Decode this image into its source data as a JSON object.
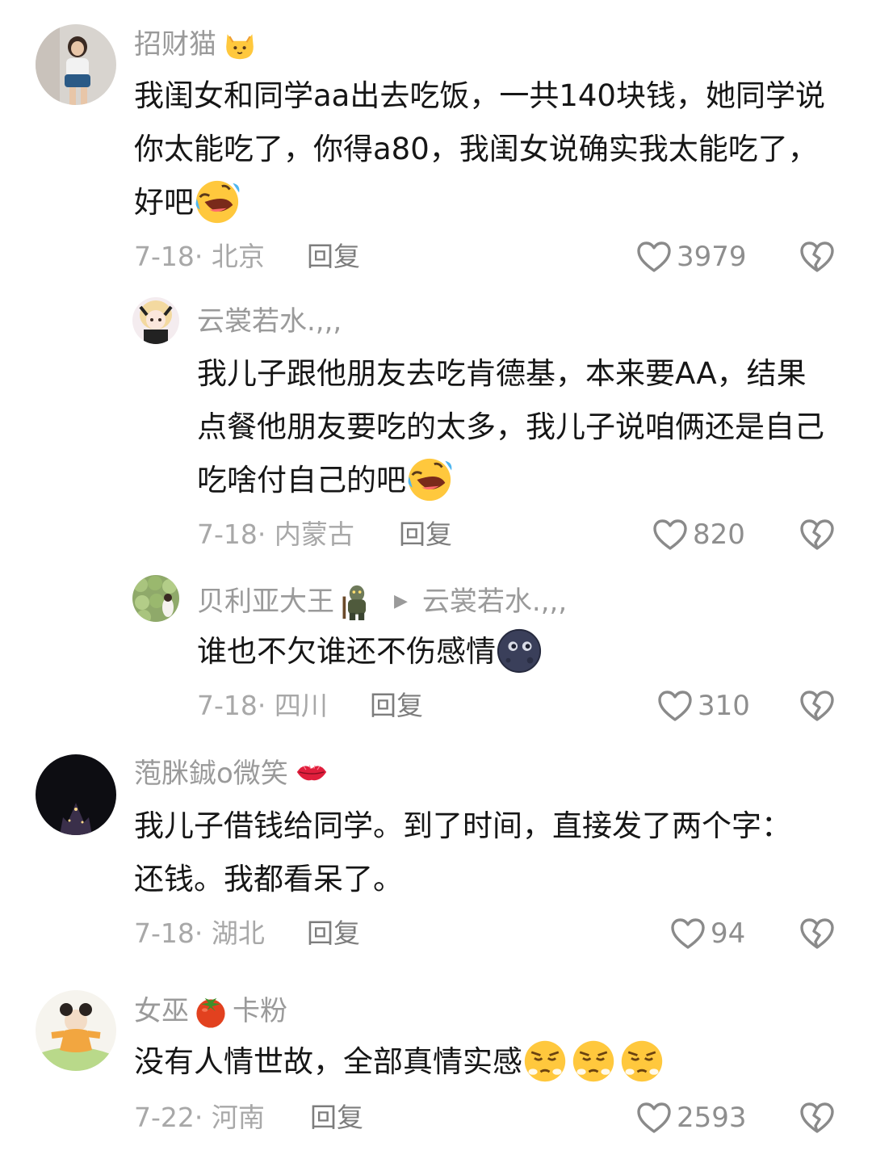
{
  "comments": [
    {
      "user": "招财猫",
      "text": "我闺女和同学aa出去吃饭，一共140块钱，她同学说你太能吃了，你得a80，我闺女说确实我太能吃了，好吧",
      "date_location": "7-18· 北京",
      "reply_label": "回复",
      "likes": "3979",
      "avatar_icon": "girl-photo-avatar",
      "badge_icon": "cat-face-emoji",
      "emoji": [
        "rofl-crying-emoji"
      ]
    },
    {
      "user": "云裳若水.,,,",
      "text": "我儿子跟他朋友去吃肯德基，本来要AA，结果点餐他朋友要吃的太多，我儿子说咱俩还是自己吃啥付自己的吧",
      "date_location": "7-18· 内蒙古",
      "reply_label": "回复",
      "likes": "820",
      "avatar_icon": "anime-girl-avatar",
      "emoji": [
        "rofl-crying-emoji"
      ]
    },
    {
      "user": "贝利亚大王",
      "reply_to": "云裳若水.,,,",
      "text": "谁也不欠谁还不伤感情",
      "date_location": "7-18· 四川",
      "reply_label": "回复",
      "likes": "310",
      "avatar_icon": "melon-field-avatar",
      "badge_icon": "troll-figure-icon",
      "emoji": [
        "new-moon-face-emoji"
      ]
    },
    {
      "user": "萢脒鋮ο微笑",
      "text": "我儿子借钱给同学。到了时间，直接发了两个字：还钱。我都看呆了。",
      "date_location": "7-18· 湖北",
      "reply_label": "回复",
      "likes": "94",
      "avatar_icon": "night-castle-avatar",
      "badge_icon": "kiss-lips-emoji"
    },
    {
      "user_parts": [
        "女巫",
        "卡粉"
      ],
      "text": "没有人情世故，全部真情实感",
      "date_location": "7-22· 河南",
      "reply_label": "回复",
      "likes": "2593",
      "avatar_icon": "cartoon-kid-avatar",
      "badge_icon": "tomato-emoji",
      "emoji": [
        "huffing-face-emoji",
        "huffing-face-emoji",
        "huffing-face-emoji"
      ]
    }
  ],
  "icons": {
    "like": "heart-outline-icon",
    "dislike": "broken-heart-icon"
  }
}
